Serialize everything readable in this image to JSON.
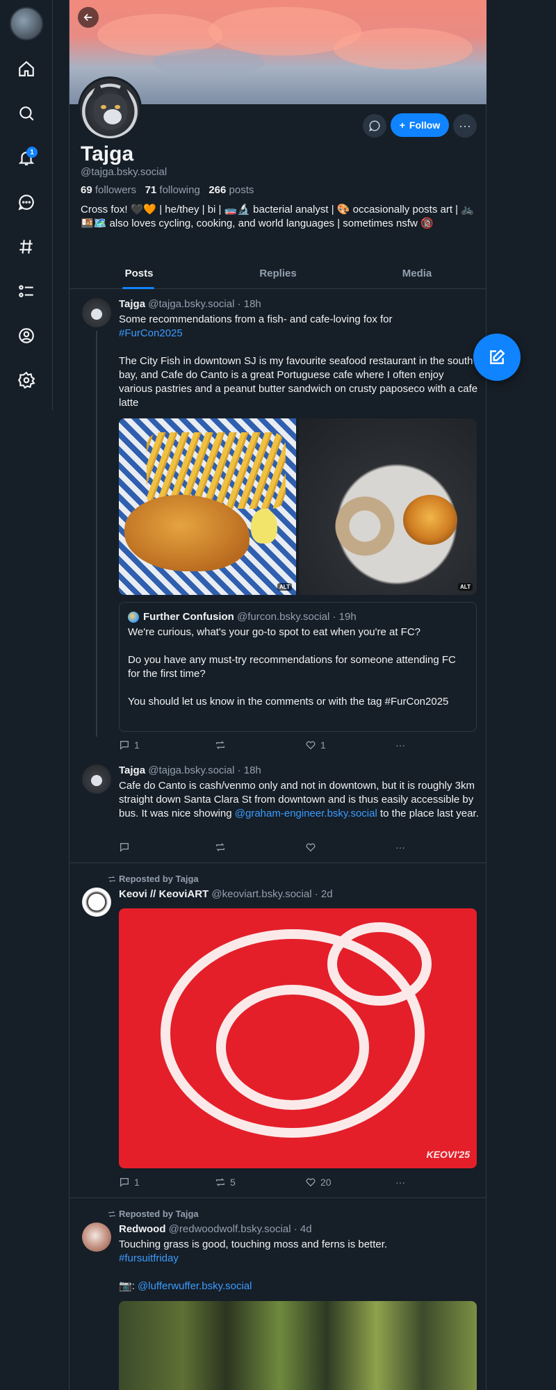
{
  "sidebar": {
    "notification_count": "1"
  },
  "profile": {
    "name": "Tajga",
    "handle": "@tajga.bsky.social",
    "followers_count": "69",
    "followers_label": "followers",
    "following_count": "71",
    "following_label": "following",
    "posts_count": "266",
    "posts_label": "posts",
    "bio": "Cross fox! 🖤🧡 | he/they | bi | 🧫🔬 bacterial analyst | 🎨 occasionally posts art | 🚲🍱🗺️ also loves cycling, cooking, and world languages | sometimes nsfw 🔞",
    "follow_label": "Follow"
  },
  "tabs": [
    "Posts",
    "Replies",
    "Media"
  ],
  "posts": [
    {
      "author": "Tajga",
      "handle": "@tajga.bsky.social · 18h",
      "text_1": "Some recommendations from a fish- and cafe-loving fox for",
      "hashtag": "#FurCon2025",
      "text_2": "The City Fish in downtown SJ is my favourite seafood restaurant in the south bay, and Cafe do Canto is a great Portuguese cafe where I often enjoy various pastries and a peanut butter sandwich on crusty paposeco with a cafe latte",
      "alt_1": "ALT",
      "alt_2": "ALT",
      "quote": {
        "author": "Further Confusion",
        "handle": "@furcon.bsky.social · 19h",
        "p1": "We're curious, what's your go-to spot to eat when you're at FC?",
        "p2": "Do you have any must-try recommendations for someone attending FC for the first time?",
        "p3": "You should let us know in the comments or with the tag #FurCon2025"
      },
      "replies": "1",
      "reposts": "",
      "likes": "1"
    },
    {
      "author": "Tajga",
      "handle": "@tajga.bsky.social · 18h",
      "text_1": "Cafe do Canto is cash/venmo only and not in downtown, but it is roughly 3km straight down Santa Clara St from downtown and is thus easily accessible by bus. It was nice showing",
      "mention": "@graham-engineer.bsky.social",
      "text_2": "to the place last year."
    },
    {
      "reposted_by": "Reposted by Tajga",
      "author": "Keovi // KeoviART",
      "handle": "@keoviart.bsky.social · 2d",
      "art_signature": "KEOVI'25",
      "replies": "1",
      "reposts": "5",
      "likes": "20"
    },
    {
      "reposted_by": "Reposted by Tajga",
      "author": "Redwood",
      "handle": "@redwoodwolf.bsky.social · 4d",
      "text": "Touching grass is good, touching moss and ferns is better.",
      "hashtag": "#fursuitfriday",
      "credit_prefix": "📷:",
      "credit_mention": "@lufferwuffer.bsky.social"
    }
  ],
  "colors": {
    "accent": "#1083fe",
    "background": "#161e27",
    "link": "#3b9cff",
    "muted": "#93a0b0"
  }
}
